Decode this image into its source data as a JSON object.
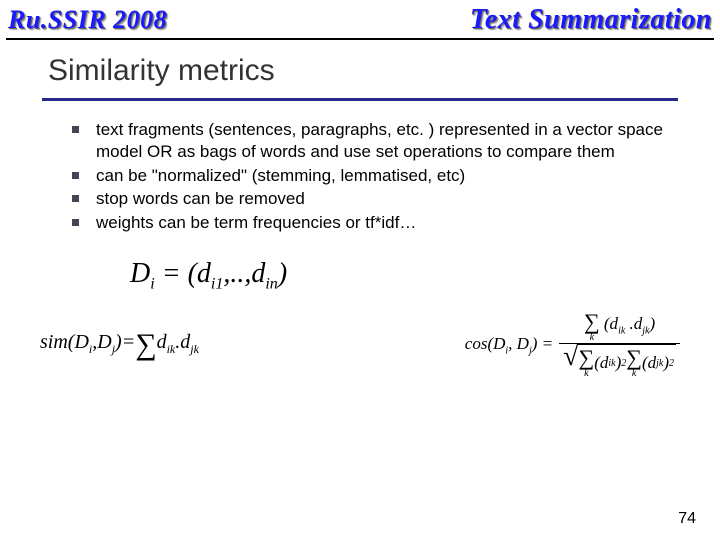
{
  "header": {
    "left": "Ru.SSIR 2008",
    "right": "Text Summarization"
  },
  "title": "Similarity metrics",
  "bullets": [
    "text fragments (sentences, paragraphs, etc. ) represented in a vector space model  OR as bags of words and use set operations to compare them",
    "can be \"normalized\" (stemming, lemmatised, etc)",
    "stop words can be removed",
    "weights can be term frequencies or tf*idf…"
  ],
  "formulas": {
    "eq1_lhs": "D",
    "eq1_sub": "i",
    "eq1_rhs_open": " = (d",
    "eq1_rhs_s1": "i1",
    "eq1_rhs_mid": ",..,d",
    "eq1_rhs_s2": "in",
    "eq1_rhs_close": ")",
    "eq2_lhs": "sim(D",
    "eq2_s1": "i",
    "eq2_mid1": ",D",
    "eq2_s2": "j",
    "eq2_mid2": ")=",
    "sigma": "∑",
    "eq2_term": "d",
    "eq2_ts1": "ik",
    "eq2_dot": ".d",
    "eq2_ts2": "jk",
    "eq3_lhs": "cos(D",
    "eq3_s1": "i",
    "eq3_mid1": ", D",
    "eq3_s2": "j",
    "eq3_mid2": ") =",
    "k": "k",
    "num_open": "(d",
    "num_s1": "ik",
    "num_mid": " .d",
    "num_s2": "jk",
    "num_close": ")",
    "den_t1_open": "(d",
    "den_t1_s": "ik",
    "den_t1_close": ")",
    "sq": "2",
    "den_t2_open": "(d",
    "den_t2_s": "jk",
    "den_t2_close": ")",
    "radical": "√"
  },
  "pagenum": "74"
}
